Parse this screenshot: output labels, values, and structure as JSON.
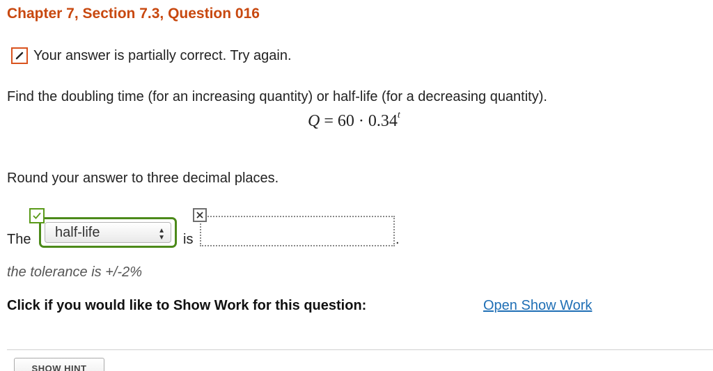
{
  "header": {
    "title": "Chapter 7, Section 7.3, Question 016"
  },
  "status": {
    "icon": "pencil-icon",
    "message": "Your answer is partially correct.  Try again.",
    "color": "#d9531e"
  },
  "question": {
    "prompt": "Find the doubling time (for an increasing quantity) or half-life (for a decreasing quantity).",
    "formula_lhs": "Q",
    "formula_rhs": " = 60 · 0.34",
    "formula_exponent": "t",
    "rounding_note": "Round your answer to three decimal places."
  },
  "answer": {
    "prefix": "The",
    "select_value": "half-life",
    "select_icon": "up-down-arrows-icon",
    "select_status_icon": "checkmark-icon",
    "connector": "is",
    "input_value": "",
    "input_status_icon": "x-mark-icon",
    "suffix": ".",
    "tolerance": "the tolerance is +/-2%"
  },
  "show_work": {
    "label": "Click if you would like to Show Work for this question:",
    "link": "Open Show Work"
  },
  "hint": {
    "button_label": "SHOW HINT"
  },
  "colors": {
    "title": "#c8480f",
    "correct": "#4c8a1a",
    "link": "#1f6fb5"
  }
}
